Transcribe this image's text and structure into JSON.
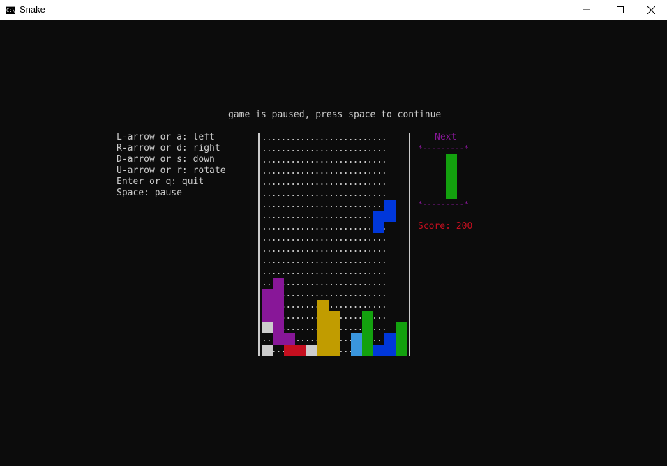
{
  "window": {
    "title": "Snake",
    "icon": "console-icon",
    "controls": [
      "minimize-icon",
      "maximize-icon",
      "close-icon"
    ]
  },
  "game": {
    "pause_message": "game is paused, press space to continue",
    "help": [
      "L-arrow or a: left",
      "R-arrow or d: right",
      "D-arrow or s: down",
      "U-arrow or r: rotate",
      "Enter or q: quit",
      "Space: pause"
    ],
    "next_label": "Next",
    "next_box_top": "*---------*",
    "next_box_bottom": "*---------*",
    "score_text": "Score: 200",
    "score": 200,
    "board": {
      "rows": 20,
      "cols": 13,
      "empty_glyph": "."
    },
    "colors": {
      "text": "#cccccc",
      "next_label": "#881798",
      "score": "#c50f1f",
      "purple": "#881798",
      "gold": "#c19c00",
      "green": "#13a10e",
      "blue": "#0037da",
      "light_blue": "#3a96dd",
      "red": "#c50f1f",
      "white": "#cccccc"
    }
  }
}
